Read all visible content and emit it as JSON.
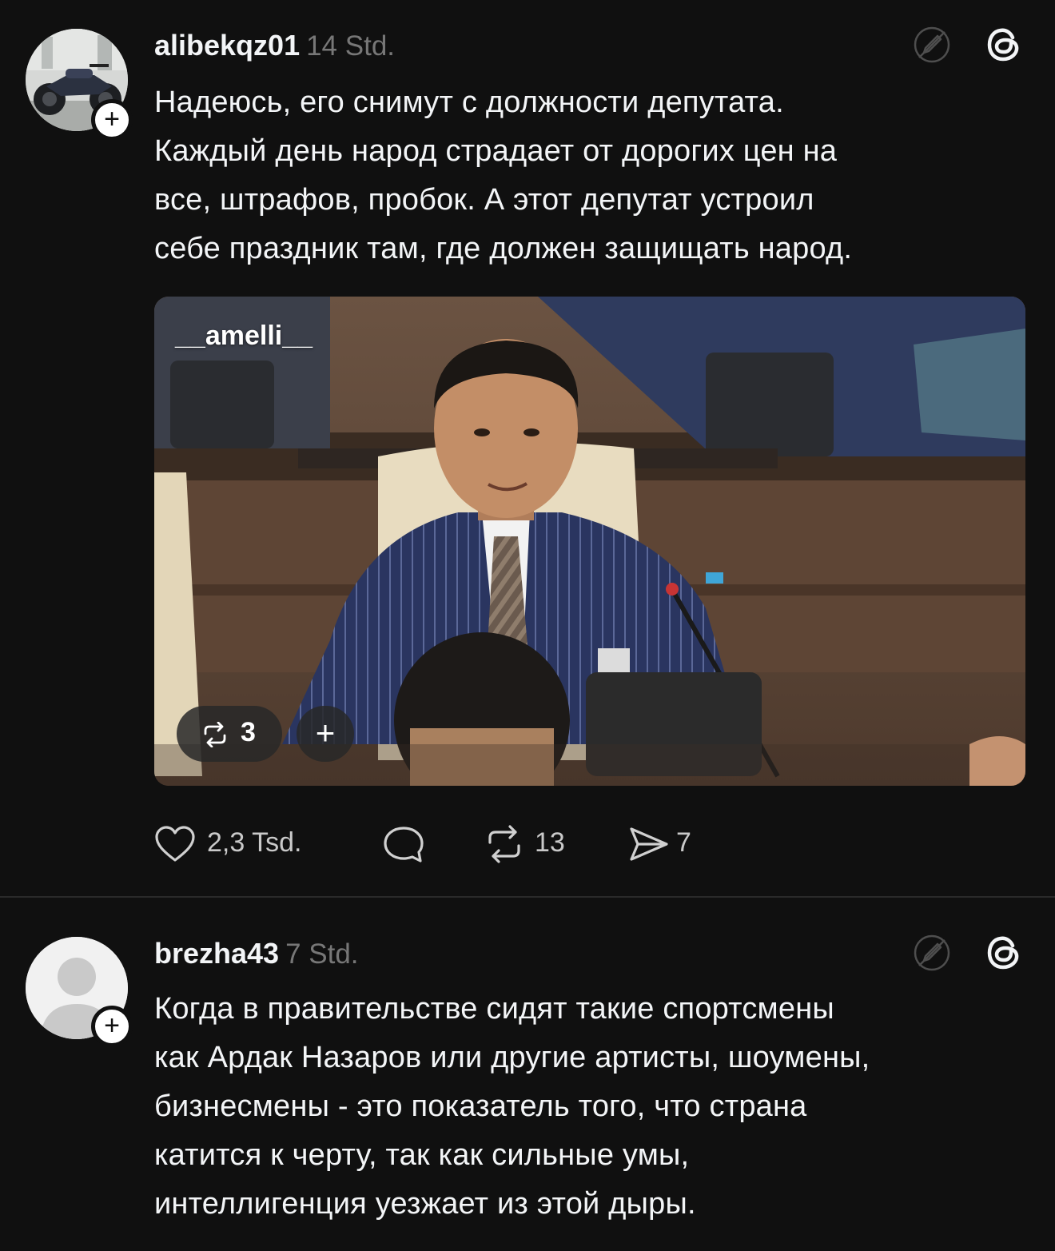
{
  "posts": [
    {
      "username": "alibekqz01",
      "time": "14 Std.",
      "text_lines": [
        "Надеюсь, его снимут с должности депутата.",
        "Каждый день народ страдает от дорогих цен на",
        "все, штрафов, пробок. А этот депутат устроил",
        "себе праздник там, где должен защищать народ."
      ],
      "media": {
        "watermark": "__amelli__",
        "repost_count": "3",
        "add_label": "+"
      },
      "actions": {
        "likes": "2,3 Tsd.",
        "reposts": "13",
        "shares": "7"
      },
      "follow_label": "+"
    },
    {
      "username": "brezha43",
      "time": "7 Std.",
      "text_lines": [
        "Когда в правительстве сидят такие спортсмены",
        "как Ардак Назаров или другие артисты, шоумены,",
        "бизнесмены - это показатель того, что страна",
        "катится к черту, так как сильные умы,",
        "интеллигенция уезжает из этой дыры."
      ],
      "follow_label": "+"
    }
  ],
  "icons": {
    "header_left": "edit-off-icon",
    "header_right": "threads-logo-icon",
    "like": "heart-icon",
    "comment": "comment-bubble-icon",
    "repost": "repost-icon",
    "share": "send-icon"
  },
  "colors": {
    "background": "#101010",
    "text_primary": "#f3f5f7",
    "text_secondary": "#777777",
    "divider": "#2a2a2a"
  }
}
